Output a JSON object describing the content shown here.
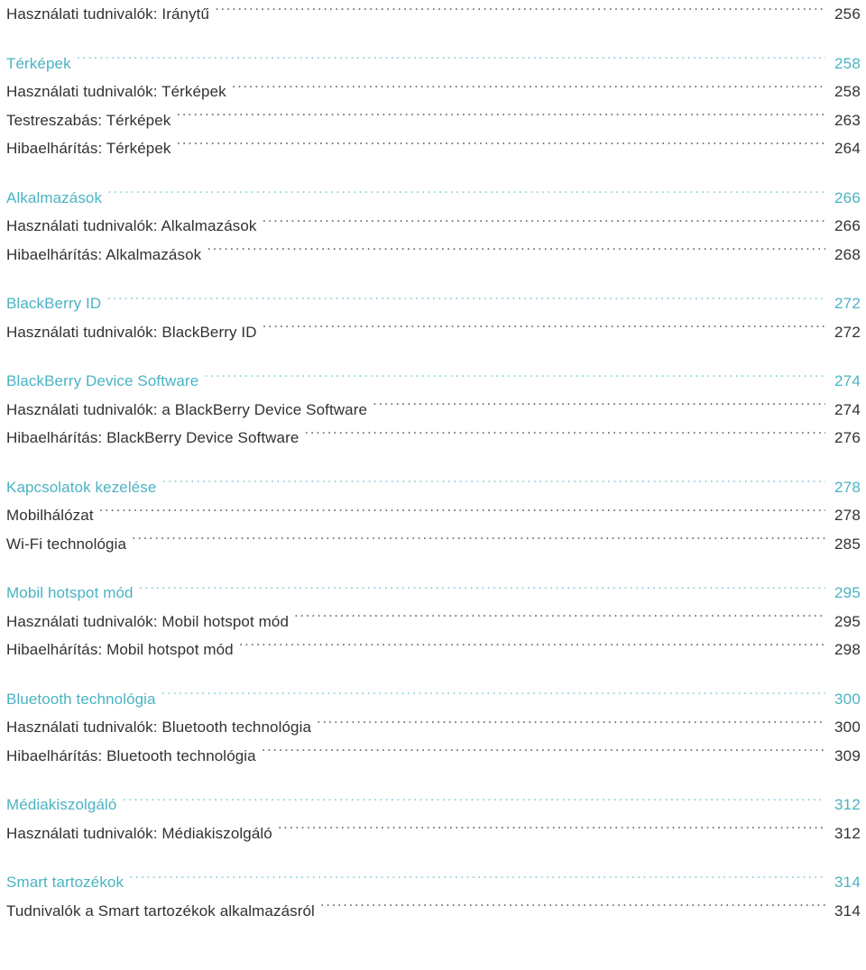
{
  "document": {
    "type": "table-of-contents",
    "language": "hu",
    "colors": {
      "heading": "#4bb3c3",
      "entry": "#2f3234",
      "leader": "#6e7174",
      "background": "#ffffff"
    }
  },
  "groups": [
    {
      "rows": [
        {
          "level": 2,
          "label": "Használati tudnivalók: Iránytű",
          "page": "256"
        }
      ]
    },
    {
      "rows": [
        {
          "level": 1,
          "label": "Térképek",
          "page": "258"
        },
        {
          "level": 2,
          "label": "Használati tudnivalók: Térképek",
          "page": "258"
        },
        {
          "level": 2,
          "label": "Testreszabás: Térképek",
          "page": "263"
        },
        {
          "level": 2,
          "label": "Hibaelhárítás: Térképek",
          "page": "264"
        }
      ]
    },
    {
      "rows": [
        {
          "level": 1,
          "label": "Alkalmazások",
          "page": "266"
        },
        {
          "level": 2,
          "label": "Használati tudnivalók: Alkalmazások",
          "page": "266"
        },
        {
          "level": 2,
          "label": "Hibaelhárítás: Alkalmazások",
          "page": "268"
        }
      ]
    },
    {
      "rows": [
        {
          "level": 1,
          "label": "BlackBerry ID",
          "page": "272"
        },
        {
          "level": 2,
          "label": "Használati tudnivalók: BlackBerry ID",
          "page": "272"
        }
      ]
    },
    {
      "rows": [
        {
          "level": 1,
          "label": "BlackBerry Device Software",
          "page": "274"
        },
        {
          "level": 2,
          "label": "Használati tudnivalók: a BlackBerry Device Software",
          "page": "274"
        },
        {
          "level": 2,
          "label": "Hibaelhárítás: BlackBerry Device Software",
          "page": "276"
        }
      ]
    },
    {
      "rows": [
        {
          "level": 1,
          "label": "Kapcsolatok kezelése",
          "page": "278"
        },
        {
          "level": 2,
          "label": "Mobilhálózat",
          "page": "278"
        },
        {
          "level": 2,
          "label": "Wi-Fi technológia",
          "page": "285"
        }
      ]
    },
    {
      "rows": [
        {
          "level": 1,
          "label": "Mobil hotspot mód",
          "page": "295"
        },
        {
          "level": 2,
          "label": "Használati tudnivalók: Mobil hotspot mód",
          "page": "295"
        },
        {
          "level": 2,
          "label": "Hibaelhárítás: Mobil hotspot mód",
          "page": "298"
        }
      ]
    },
    {
      "rows": [
        {
          "level": 1,
          "label": "Bluetooth technológia",
          "page": "300"
        },
        {
          "level": 2,
          "label": "Használati tudnivalók: Bluetooth technológia",
          "page": "300"
        },
        {
          "level": 2,
          "label": "Hibaelhárítás: Bluetooth technológia",
          "page": "309"
        }
      ]
    },
    {
      "rows": [
        {
          "level": 1,
          "label": "Médiakiszolgáló",
          "page": "312"
        },
        {
          "level": 2,
          "label": "Használati tudnivalók: Médiakiszolgáló",
          "page": "312"
        }
      ]
    },
    {
      "rows": [
        {
          "level": 1,
          "label": "Smart tartozékok",
          "page": "314"
        },
        {
          "level": 2,
          "label": "Tudnivalók a Smart tartozékok alkalmazásról",
          "page": "314"
        }
      ]
    }
  ]
}
